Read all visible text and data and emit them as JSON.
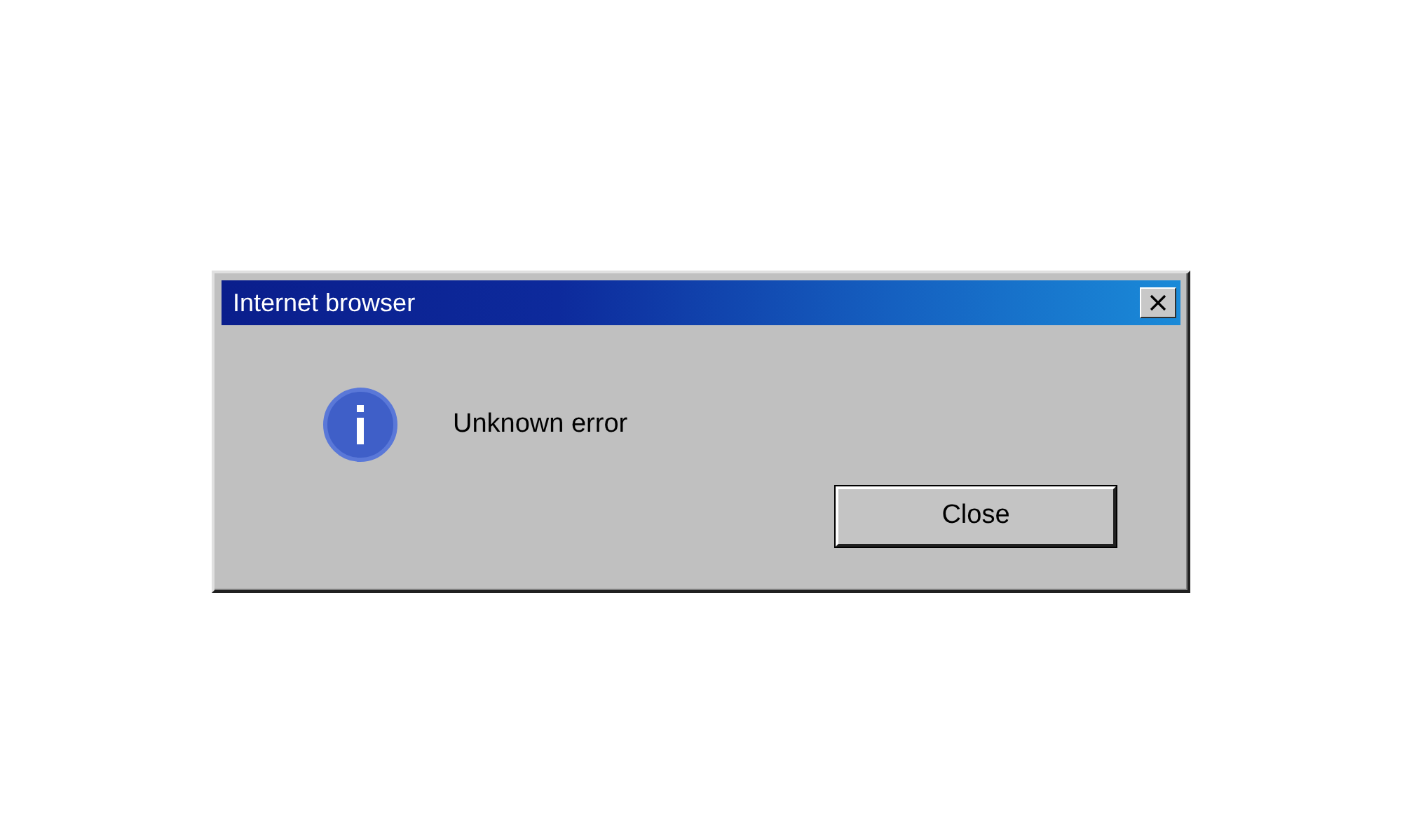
{
  "window": {
    "title": "Internet browser"
  },
  "message": "Unknown error",
  "buttons": [
    "Close"
  ]
}
